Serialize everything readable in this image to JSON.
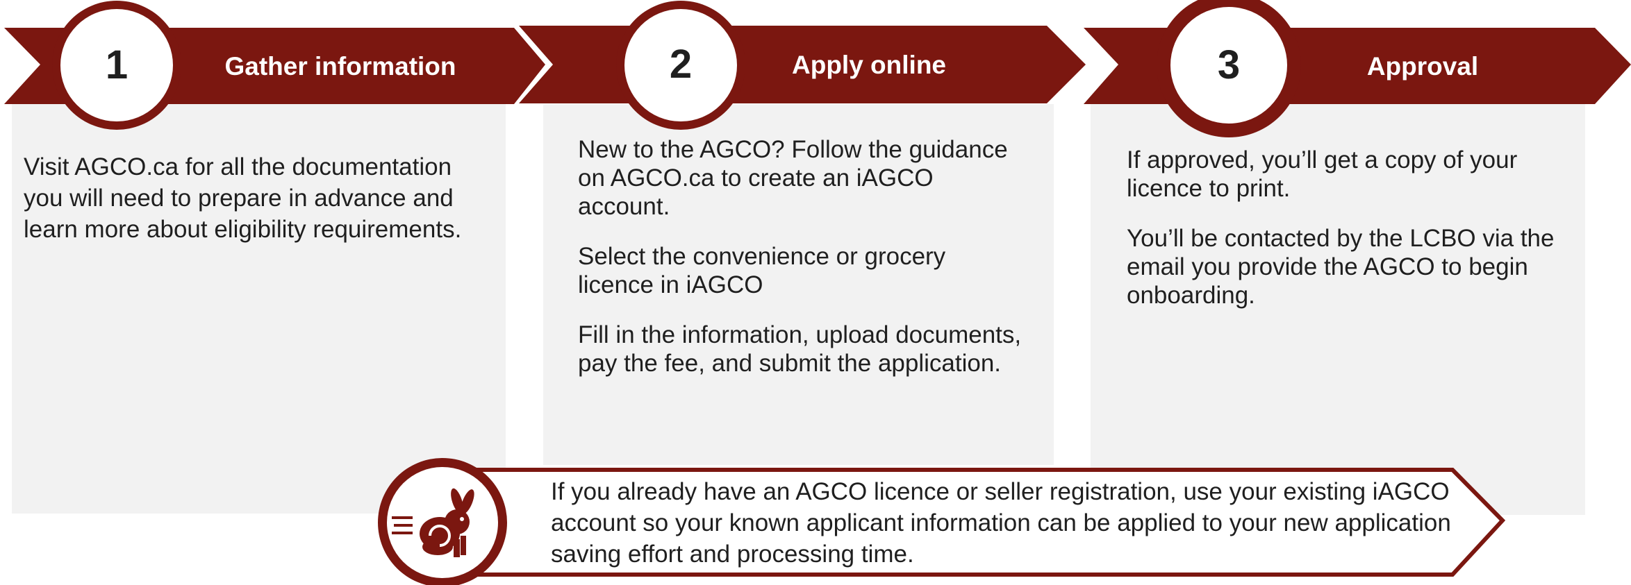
{
  "colors": {
    "accent": "#7b1710",
    "panel": "#f2f2f2",
    "text": "#1f1f1f"
  },
  "steps": [
    {
      "number": "1",
      "title": "Gather information",
      "paragraphs": [
        "Visit AGCO.ca for all the documentation you will need to prepare in advance and learn more about eligibility requirements."
      ]
    },
    {
      "number": "2",
      "title": "Apply online",
      "paragraphs": [
        "New to the AGCO? Follow the guidance on AGCO.ca to create an iAGCO account.",
        "Select the convenience or grocery licence in iAGCO",
        "Fill in the information, upload documents, pay the fee, and submit the application."
      ]
    },
    {
      "number": "3",
      "title": "Approval",
      "paragraphs": [
        "If approved, you’ll get a copy of your licence to print.",
        "You’ll be contacted by the LCBO via the email you provide the AGCO to begin onboarding."
      ]
    }
  ],
  "note": {
    "icon": "fast-rabbit-icon",
    "text": "If you already have an AGCO licence or seller registration, use your existing iAGCO account so your known applicant information can be applied to your new application saving effort and processing time."
  }
}
